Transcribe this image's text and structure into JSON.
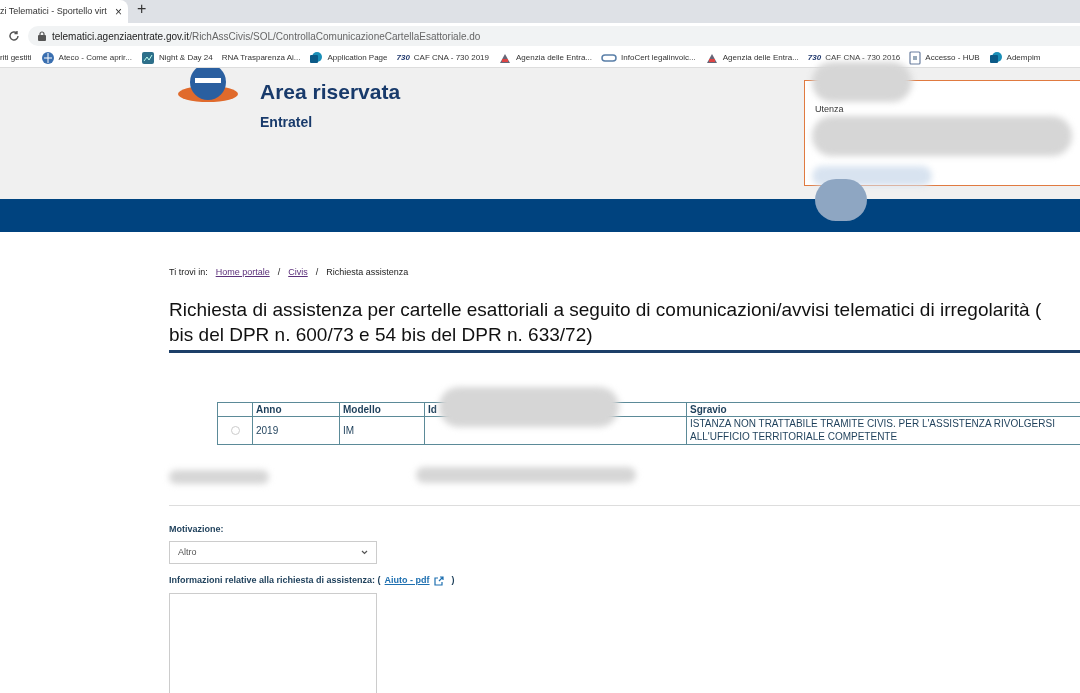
{
  "browser": {
    "tab_title": "zi Telematici - Sportello virt",
    "close_glyph": "×",
    "new_tab_glyph": "+",
    "url_host": "telematici.agenziaentrate.gov.it",
    "url_path": "/RichAssCivis/SOL/ControllaComunicazioneCartellaEsattoriale.do",
    "bookmarks": [
      {
        "label": "riti gestiti",
        "kind": "plain"
      },
      {
        "label": "Ateco - Come aprir...",
        "kind": "globe"
      },
      {
        "label": "Night & Day 24",
        "kind": "tile"
      },
      {
        "label": "RNA Trasparenza Ai...",
        "kind": "plain"
      },
      {
        "label": "Application Page",
        "kind": "sharepoint"
      },
      {
        "label": "CAF CNA - 730 2019",
        "kind": "badge",
        "badge": "730"
      },
      {
        "label": "Agenzia delle Entra...",
        "kind": "building"
      },
      {
        "label": "InfoCert legalinvoic...",
        "kind": "link"
      },
      {
        "label": "Agenzia delle Entra...",
        "kind": "building"
      },
      {
        "label": "CAF CNA - 730 2016",
        "kind": "badge",
        "badge": "730"
      },
      {
        "label": "Accesso - HUB",
        "kind": "doc"
      },
      {
        "label": "Adempim",
        "kind": "sharepoint"
      }
    ]
  },
  "header": {
    "title": "Area riservata",
    "subtitle": "Entratel",
    "user_label": "Utenza"
  },
  "breadcrumb": {
    "prefix": "Ti trovi in:",
    "items": [
      {
        "label": "Home portale",
        "link": true
      },
      {
        "label": "Civis",
        "link": true
      },
      {
        "label": "Richiesta assistenza",
        "link": false
      }
    ],
    "separator": "/"
  },
  "page_title_lines": [
    "Richiesta di assistenza per cartelle esattoriali a seguito di comunicazioni/avvisi telematici di irregolarità (",
    "bis del DPR n. 600/73 e 54 bis del DPR n. 633/72)"
  ],
  "table": {
    "columns": [
      "Anno",
      "Modello",
      "Id",
      "Sgravio"
    ],
    "rows": [
      {
        "selected": false,
        "cells": [
          "2019",
          "IM",
          "",
          "ISTANZA NON TRATTABILE TRAMITE CIVIS. PER L'ASSISTENZA RIVOLGERSI ALL'UFFICIO TERRITORIALE COMPETENTE"
        ]
      }
    ]
  },
  "form": {
    "motivation_label": "Motivazione:",
    "motivation_value": "Altro",
    "info_label": "Informazioni relative alla richiesta di assistenza: (",
    "help_link": "Aiuto - pdf",
    "info_close": ")"
  }
}
